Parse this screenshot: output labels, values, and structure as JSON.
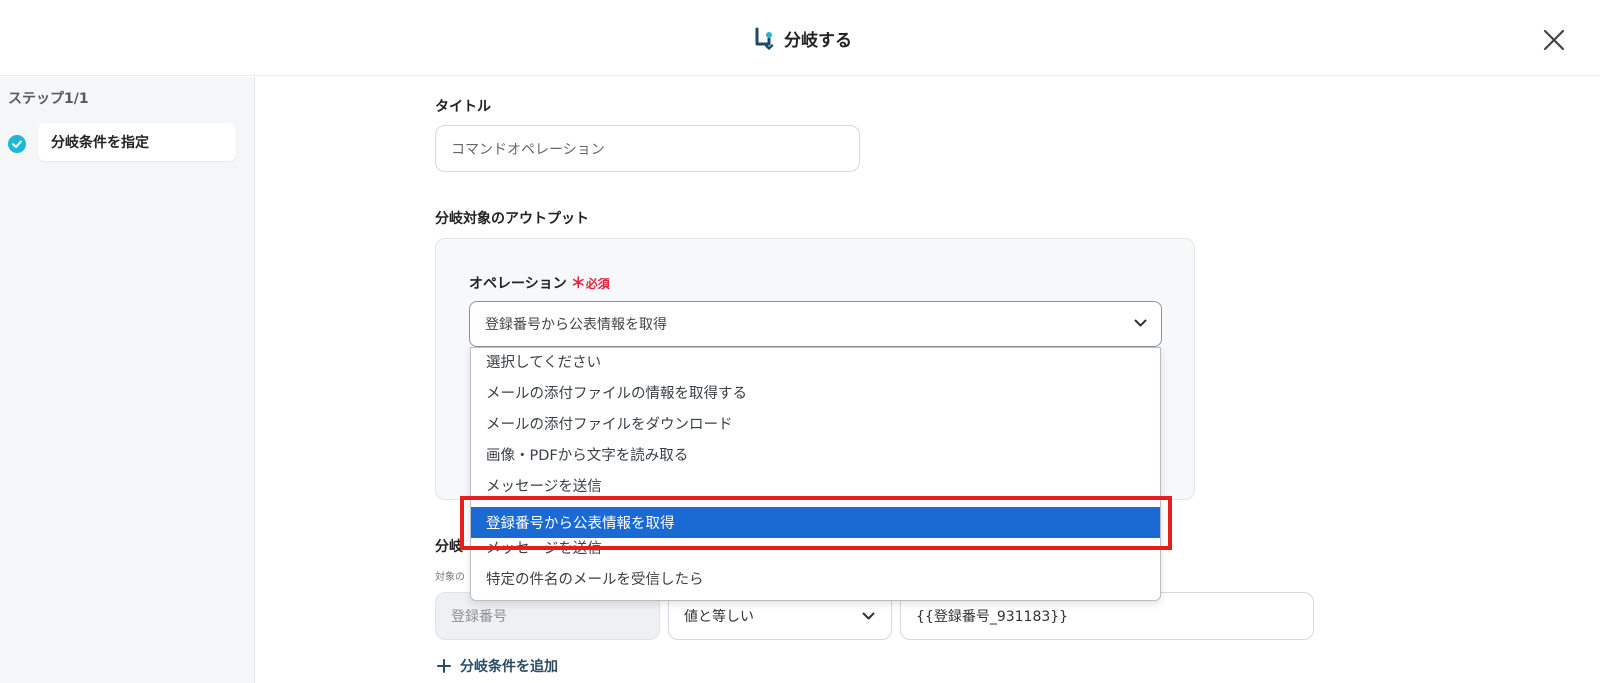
{
  "header": {
    "title": "分岐する"
  },
  "sidebar": {
    "step_label": "ステップ1/1",
    "step_item": "分岐条件を指定"
  },
  "form": {
    "title_label": "タイトル",
    "title_value": "コマンドオペレーション",
    "output_label": "分岐対象のアウトプット",
    "operation_label": "オペレーション",
    "required_mark": "＊",
    "required_text": "必須",
    "operation_selected": "登録番号から公表情報を取得",
    "operation_options": [
      "選択してください",
      "メールの添付ファイルの情報を取得する",
      "メールの添付ファイルをダウンロード",
      "画像・PDFから文字を読み取る",
      "メッセージを送信",
      "登録番号から公表情報を取得",
      "メッセージを送信",
      "特定の件名のメールを受信したら"
    ],
    "condition_label_partial": "分岐",
    "condition_sub_partial": "対象の",
    "condition_field": "登録番号",
    "condition_operator": "値と等しい",
    "condition_value": "{{登録番号_931183}}",
    "add_condition": "分岐条件を追加"
  }
}
